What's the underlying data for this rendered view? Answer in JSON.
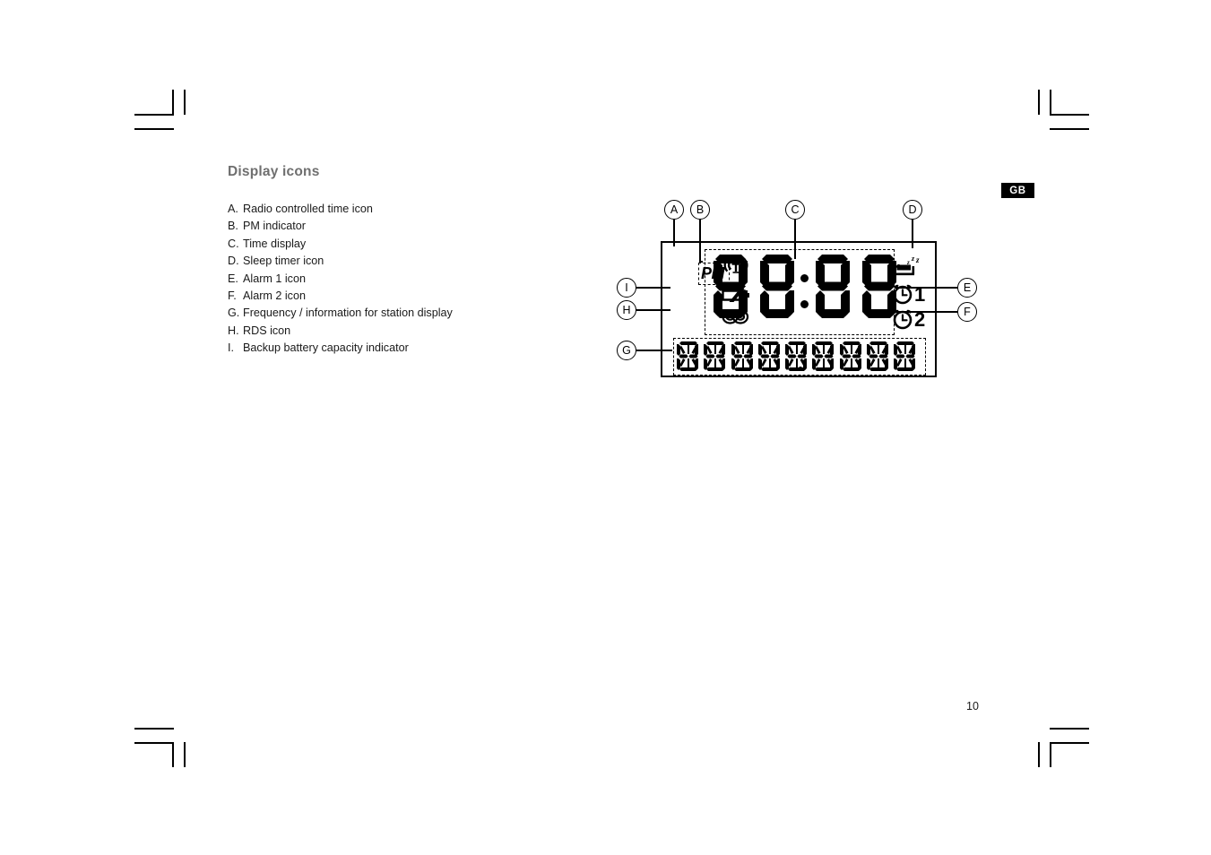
{
  "document": {
    "heading": "Display icons",
    "page_number": "10",
    "language_badge": "GB"
  },
  "icon_list": [
    {
      "key": "A.",
      "text": "Radio controlled time icon"
    },
    {
      "key": "B.",
      "text": "PM indicator"
    },
    {
      "key": "C.",
      "text": "Time display"
    },
    {
      "key": "D.",
      "text": "Sleep timer icon"
    },
    {
      "key": "E.",
      "text": "Alarm 1 icon"
    },
    {
      "key": "F.",
      "text": "Alarm 2 icon"
    },
    {
      "key": "G.",
      "text": "Frequency / information for station display"
    },
    {
      "key": "H.",
      "text": "RDS icon"
    },
    {
      "key": "I.",
      "text": "Backup battery capacity indicator"
    }
  ],
  "diagram": {
    "callouts": {
      "a": "A",
      "b": "B",
      "c": "C",
      "d": "D",
      "e": "E",
      "f": "F",
      "g": "G",
      "h": "H",
      "i": "I"
    },
    "lcd": {
      "pm_indicator": "PM",
      "time_digits": "88:88",
      "alarm1_number": "1",
      "alarm2_number": "2",
      "text_cell_count": 9,
      "icons": {
        "radio": "radio-tower-icon",
        "battery": "battery-icon",
        "rds": "rds-icon",
        "sleep": "sleep-timer-icon",
        "alarm1": "alarm-clock-icon",
        "alarm2": "alarm-clock-icon"
      }
    }
  },
  "colors": {
    "heading": "#6f6f6f",
    "text": "#1a1a1a",
    "lcd_segment": "#000000",
    "badge_bg": "#000000"
  }
}
